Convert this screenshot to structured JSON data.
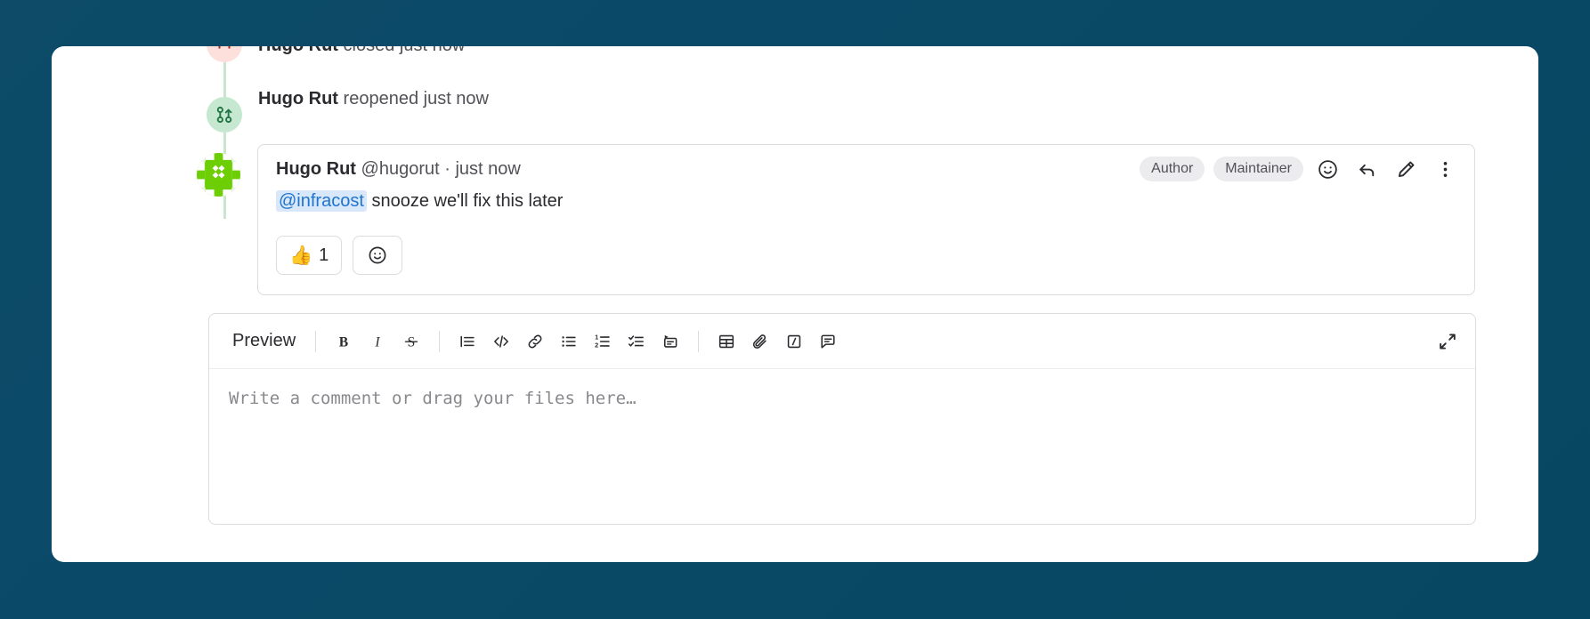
{
  "timeline": [
    {
      "id": "closed",
      "icon": "issue-closed-icon",
      "actor": "Hugo Rut",
      "action": "closed just now"
    },
    {
      "id": "reopened",
      "icon": "merge-request-reopened-icon",
      "actor": "Hugo Rut",
      "action": "reopened just now"
    }
  ],
  "comment": {
    "avatar_name": "user-avatar-identicon",
    "author": "Hugo Rut",
    "handle": "@hugorut",
    "separator": "·",
    "timestamp": "just now",
    "badges": [
      "Author",
      "Maintainer"
    ],
    "header_actions": [
      {
        "name": "add-reaction-icon",
        "label": "Add reaction"
      },
      {
        "name": "reply-icon",
        "label": "Reply"
      },
      {
        "name": "edit-pencil-icon",
        "label": "Edit comment"
      },
      {
        "name": "more-actions-kebab-icon",
        "label": "More actions"
      }
    ],
    "body": {
      "mention": "@infracost",
      "text": " snooze we'll fix this later"
    },
    "reactions": [
      {
        "name": "thumbsup-reaction",
        "emoji": "👍",
        "count": "1"
      }
    ],
    "add_reaction_label": "Add reaction"
  },
  "editor": {
    "preview_tab": "Preview",
    "placeholder": "Write a comment or drag your files here…",
    "expand_label": "Go full screen",
    "toolbar": [
      {
        "name": "bold-icon",
        "label": "Bold text"
      },
      {
        "name": "italic-icon",
        "label": "Italic text"
      },
      {
        "name": "strikethrough-icon",
        "label": "Strikethrough"
      },
      {
        "name": "blockquote-icon",
        "label": "Insert a quote"
      },
      {
        "name": "code-icon",
        "label": "Insert code"
      },
      {
        "name": "link-icon",
        "label": "Add a link"
      },
      {
        "name": "bullet-list-icon",
        "label": "Add a bullet list"
      },
      {
        "name": "numbered-list-icon",
        "label": "Add a numbered list"
      },
      {
        "name": "task-list-icon",
        "label": "Add a checklist"
      },
      {
        "name": "indent-collapsible-icon",
        "label": "Add a collapsible section"
      },
      {
        "name": "table-icon",
        "label": "Insert table"
      },
      {
        "name": "attachment-icon",
        "label": "Attach a file or image"
      },
      {
        "name": "quick-actions-icon",
        "label": "Quick actions"
      },
      {
        "name": "comment-template-icon",
        "label": "Insert comment template"
      }
    ]
  },
  "colors": {
    "page_background": "#0a4f6e",
    "card_background": "#ffffff",
    "border": "#dcdcde",
    "text_primary": "#2b2a2e",
    "text_secondary": "#535158",
    "mention_text": "#1f75cb",
    "mention_background": "#d9e7fb",
    "badge_background": "#ececef",
    "timeline_rail": "#c9e5cf",
    "timeline_closed_background": "#fddfdc",
    "timeline_reopened_background": "#c7e8d0",
    "identicon_green": "#6ece05"
  }
}
